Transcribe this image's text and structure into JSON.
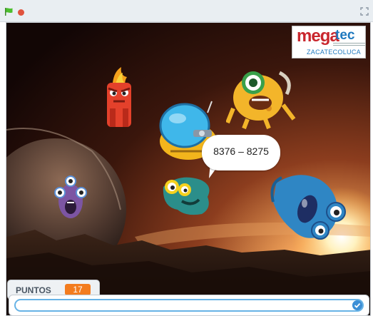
{
  "controls": {
    "green_flag_icon": "green-flag-icon",
    "stop_icon": "stop-sign-icon",
    "fullscreen_icon": "fullscreen-icon"
  },
  "logo": {
    "brand_part1": "mega",
    "brand_part2": "tec",
    "city": "ZACATECOLUCA"
  },
  "question": {
    "text": "8376 – 8275"
  },
  "score": {
    "label": "PUNTOS",
    "value": "17"
  },
  "answer": {
    "value": "",
    "submit_icon": "check-icon"
  },
  "colors": {
    "score_badge": "#f37c1f",
    "input_border": "#67b3e6",
    "brand_red": "#c9262d",
    "brand_blue": "#1f79bf"
  }
}
